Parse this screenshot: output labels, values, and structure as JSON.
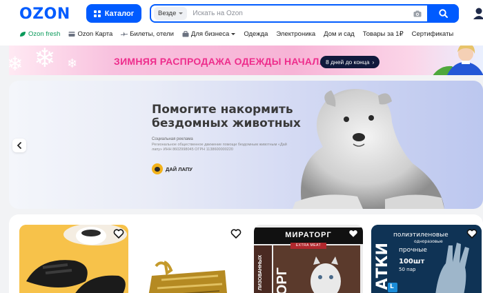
{
  "header": {
    "logo": "OZON",
    "catalog_label": "Каталог",
    "search": {
      "scope": "Везде",
      "placeholder": "Искать на Ozon"
    }
  },
  "nav": [
    {
      "label": "Ozon fresh",
      "icon": "leaf-icon"
    },
    {
      "label": "Ozon Карта",
      "icon": "card-icon"
    },
    {
      "label": "Билеты, отели",
      "icon": "plane-icon"
    },
    {
      "label": "Для бизнеса",
      "icon": "briefcase-icon"
    },
    {
      "label": "Одежда"
    },
    {
      "label": "Электроника"
    },
    {
      "label": "Дом и сад"
    },
    {
      "label": "Товары за 1₽"
    },
    {
      "label": "Сертификаты"
    }
  ],
  "promo": {
    "text": "ЗИМНЯЯ РАСПРОДАЖА ОДЕЖДЫ НАЧАЛАСЬ!",
    "badge": "8 дней до конца"
  },
  "banner": {
    "title": "Помогите накормить бездомных животных",
    "ad_label": "Социальная реклама",
    "org_text": "Региональное общественное движение помощи бездомным животным «Дай лапу» ИНН 8602998045 ОГРН 1138600000220",
    "logo_text": "ДАЙ ЛАПУ"
  },
  "products": [
    {
      "image": "slippers-photo"
    },
    {
      "image": "gold-sculpture-photo"
    },
    {
      "image": "cat-food-photo",
      "brand": "МИРАТОРГ",
      "sub": "EXTRA MEAT",
      "side": "ОРГ",
      "side2": "ЛИЗОВАННЫХ"
    },
    {
      "image": "gloves-photo",
      "line1": "полиэтиленовые",
      "line2": "одноразовые",
      "line3": "прочные",
      "count": "100шт",
      "pairs": "50 пар",
      "side": "АТКИ",
      "size": "L"
    }
  ],
  "colors": {
    "brand_blue": "#005bff",
    "promo_pink": "#ee2d8c",
    "fresh_green": "#0a9a5a"
  }
}
